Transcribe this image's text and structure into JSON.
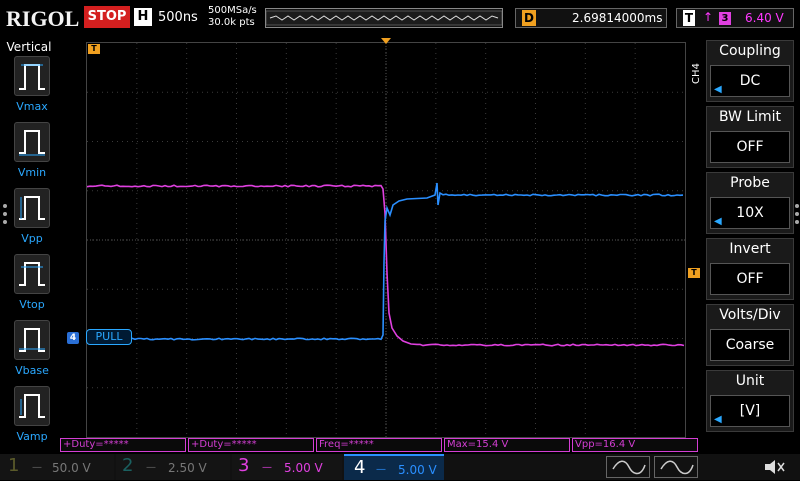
{
  "header": {
    "brand": "RIGOL",
    "run_state": "STOP",
    "horizontal_label": "H",
    "timebase": "500ns",
    "sample_rate": "500MSa/s",
    "points": "30.0k pts",
    "delay_label": "D",
    "delay": "2.69814000ms",
    "trigger_label": "T",
    "trigger_edge_icon": "rising-edge-icon",
    "trigger_source": "3",
    "trigger_level": "6.40 V"
  },
  "left_panel": {
    "title": "Vertical",
    "items": [
      {
        "label": "Vmax",
        "icon": "vmax-icon"
      },
      {
        "label": "Vmin",
        "icon": "vmin-icon"
      },
      {
        "label": "Vpp",
        "icon": "vpp-icon"
      },
      {
        "label": "Vtop",
        "icon": "vtop-icon"
      },
      {
        "label": "Vbase",
        "icon": "vbase-icon"
      },
      {
        "label": "Vamp",
        "icon": "vamp-icon"
      }
    ]
  },
  "right_menu": {
    "channel": "CH4",
    "items": [
      {
        "title": "Coupling",
        "value": "DC"
      },
      {
        "title": "BW Limit",
        "value": "OFF"
      },
      {
        "title": "Probe",
        "value": "10X"
      },
      {
        "title": "Invert",
        "value": "OFF"
      },
      {
        "title": "Volts/Div",
        "value": "Coarse"
      },
      {
        "title": "Unit",
        "value": "[V]"
      }
    ]
  },
  "grid": {
    "trigger_marker": "T",
    "ch4_tag": "4",
    "ch4_label": "PULL"
  },
  "measurements": [
    "+Duty=*****",
    "+Duty=*****",
    "Freq=*****",
    "Max=15.4 V",
    "Vpp=16.4 V"
  ],
  "channels": [
    {
      "num": "1",
      "scale": "50.0 V",
      "color": "#f0e020"
    },
    {
      "num": "2",
      "scale": "2.50 V",
      "color": "#1fc0c0"
    },
    {
      "num": "3",
      "scale": "5.00 V",
      "color": "#e040e0"
    },
    {
      "num": "4",
      "scale": "5.00 V",
      "color": "#2a8fff"
    }
  ],
  "colors": {
    "ch3": "#e040e0",
    "ch4": "#2a8fff",
    "trigger": "#f0a020",
    "stop": "#d41f1f"
  }
}
